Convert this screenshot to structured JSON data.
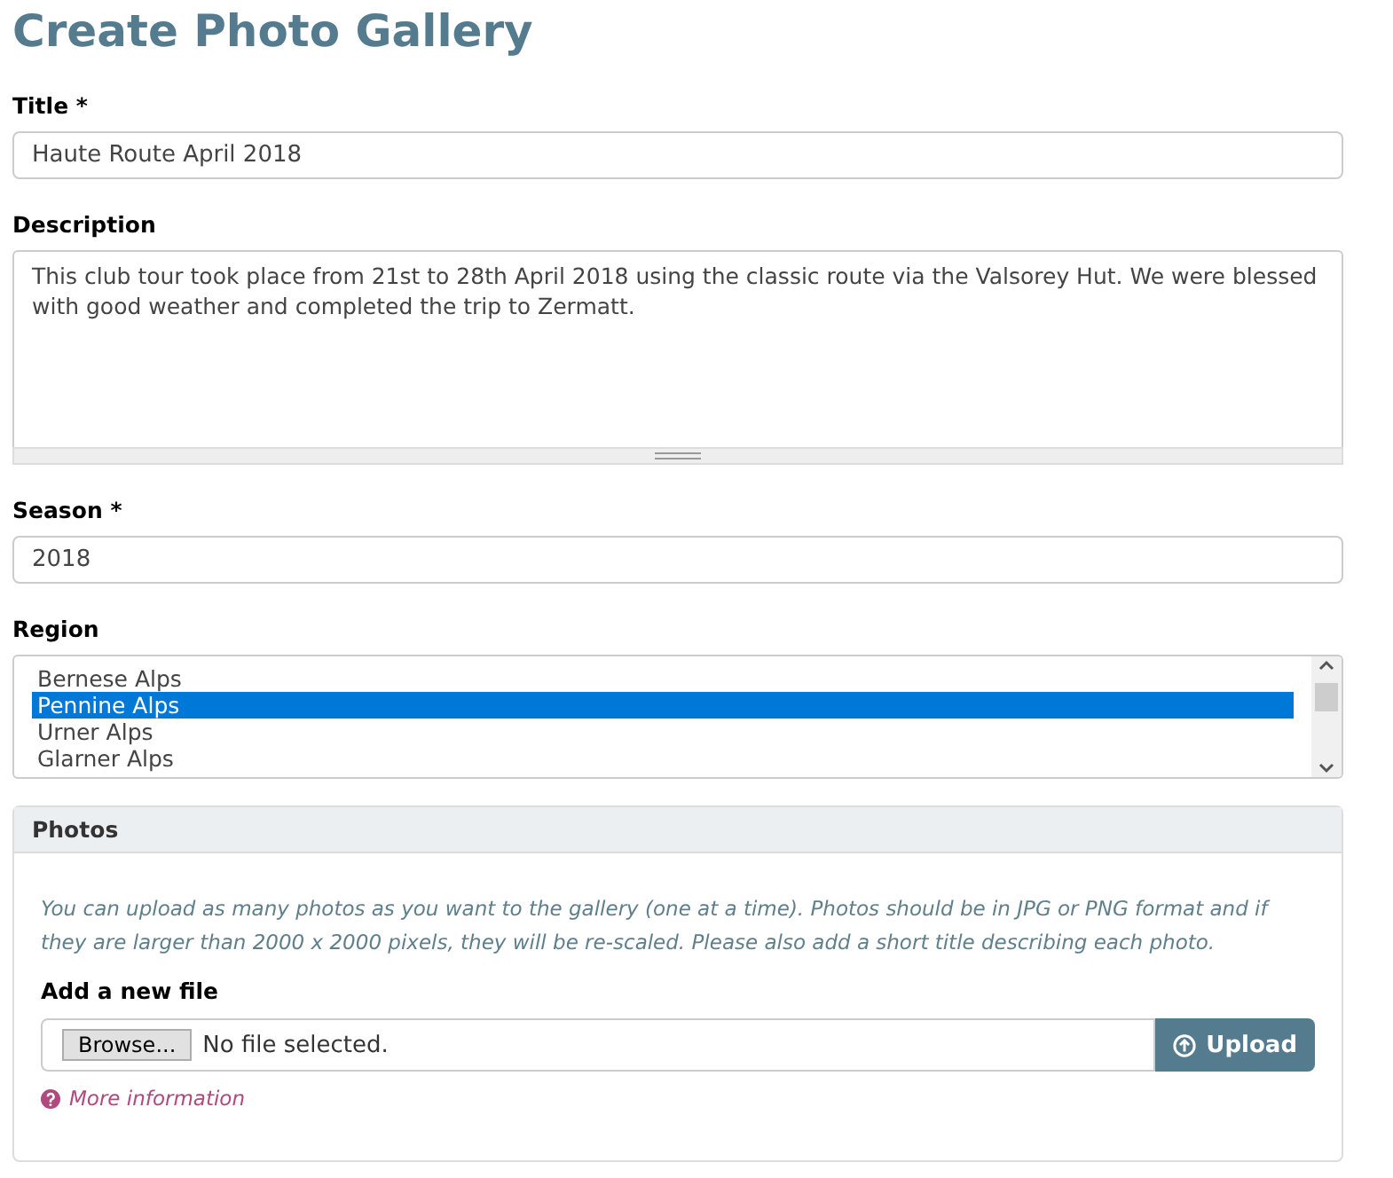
{
  "heading": "Create Photo Gallery",
  "fields": [
    {
      "kind": "input",
      "label": "Title *",
      "value": "Haute Route April 2018"
    },
    {
      "kind": "textarea",
      "label": "Description",
      "value": "This club tour took place from 21st to 28th April 2018 using the classic route via the Valsorey Hut. We were blessed with good weather and completed the trip to Zermatt."
    },
    {
      "kind": "input",
      "label": "Season *",
      "value": "2018"
    },
    {
      "kind": "listbox",
      "label": "Region",
      "options": [
        {
          "label": "Bernese Alps",
          "selected": false
        },
        {
          "label": "Pennine Alps",
          "selected": true
        },
        {
          "label": "Urner Alps",
          "selected": false
        },
        {
          "label": "Glarner Alps",
          "selected": false
        }
      ]
    }
  ],
  "photos": {
    "title": "Photos",
    "help": "You can upload as many photos as you want to the gallery (one at a time). Photos should be in JPG or PNG format and if they are larger than 2000 x 2000 pixels, they will be re-scaled. Please also add a short title describing each photo.",
    "file_label": "Add a new file",
    "browse": "Browse...",
    "file_status": "No file selected.",
    "upload": "Upload",
    "more_info": "More information"
  }
}
